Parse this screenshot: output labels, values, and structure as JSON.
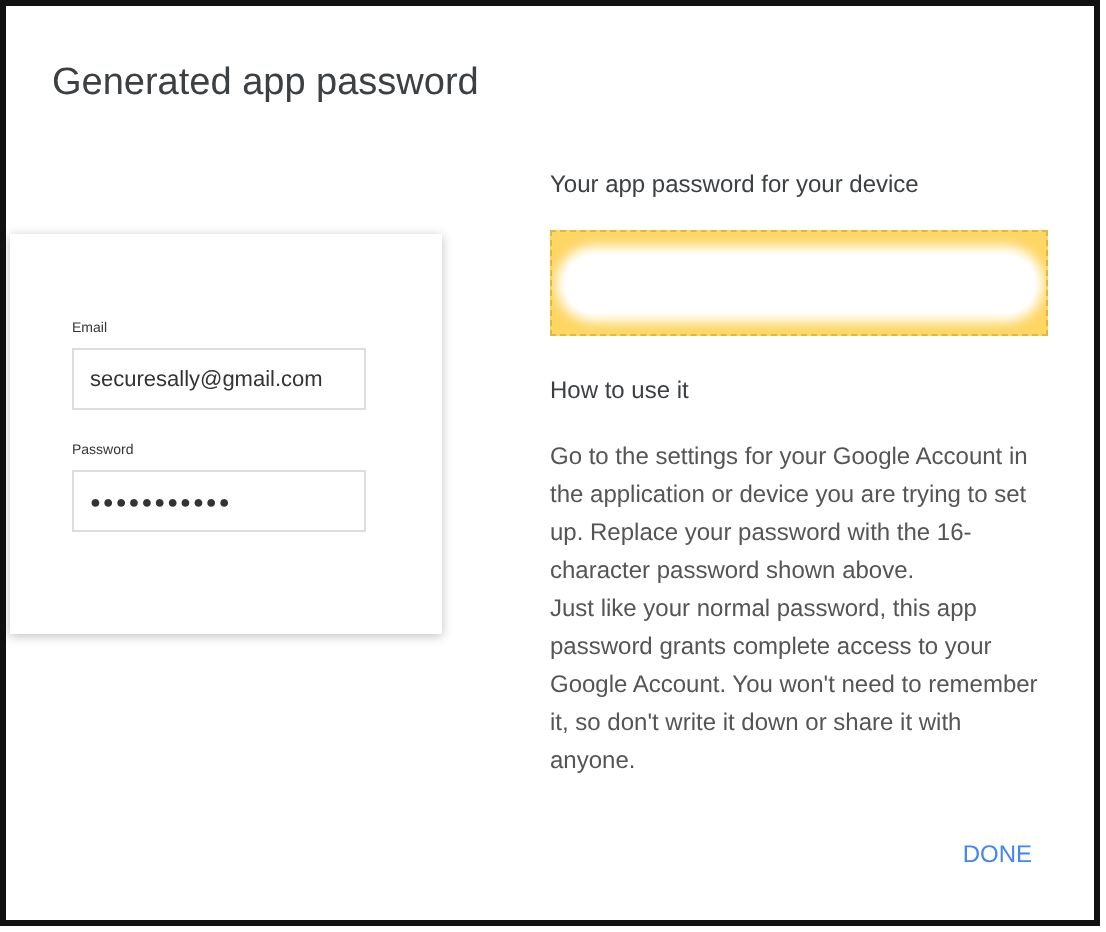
{
  "dialog": {
    "title": "Generated app password"
  },
  "sign_in_card": {
    "fields": [
      {
        "label": "Email",
        "value": "securesally@gmail.com",
        "kind": "text"
      },
      {
        "label": "Password",
        "value": "●●●●●●●●●●●",
        "kind": "password"
      }
    ]
  },
  "password_panel": {
    "heading": "Your app password for your device"
  },
  "instructions": {
    "heading": "How to use it",
    "paragraphs": [
      "Go to the settings for your Google Account in the application or device you are trying to set up. Replace your password with the 16-character password shown above.",
      "Just like your normal password, this app password grants complete access to your Google Account. You won't need to remember it, so don't write it down or share it with anyone."
    ]
  },
  "buttons": [
    "DONE"
  ]
}
